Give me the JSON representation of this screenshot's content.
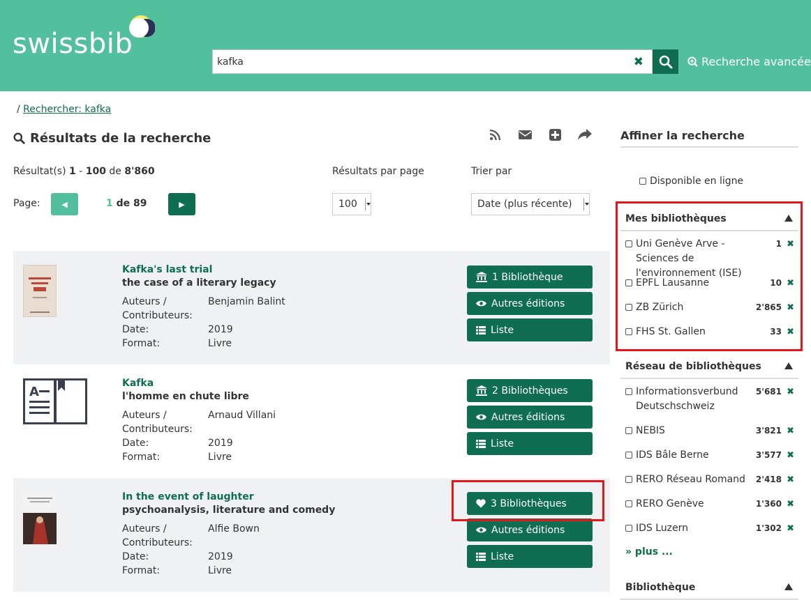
{
  "header": {
    "logo": "swissbib",
    "search_value": "kafka",
    "advanced_search": "Recherche avancée"
  },
  "breadcrumb": {
    "sep": "/",
    "link": "Rechercher: kafka"
  },
  "results": {
    "title": "Résultats de la recherche",
    "count_prefix": "Résultat(s)",
    "range_start": "1",
    "range_sep": "-",
    "range_end": "100",
    "of_word": "de",
    "total": "8'860",
    "per_page_label": "Résultats par page",
    "sort_label": "Trier par",
    "page_label": "Page:",
    "current_page": "1",
    "of_pages": "de 89",
    "per_page_value": "100",
    "sort_value": "Date (plus récente)"
  },
  "meta_labels": {
    "authors": "Auteurs /",
    "contributors": "Contributeurs:",
    "date": "Date:",
    "format": "Format:"
  },
  "records": [
    {
      "title": "Kafka's last trial",
      "subtitle": "the case of a literary legacy",
      "author": "Benjamin Balint",
      "date": "2019",
      "format": "Livre",
      "libraries_button": "1 Bibliothèque",
      "editions_button": "Autres éditions",
      "list_button": "Liste"
    },
    {
      "title": "Kafka",
      "subtitle": "l'homme en chute libre",
      "author": "Arnaud Villani",
      "date": "2019",
      "format": "Livre",
      "libraries_button": "2 Bibliothèques",
      "editions_button": "Autres éditions",
      "list_button": "Liste"
    },
    {
      "title": "In the event of laughter",
      "subtitle": "psychoanalysis, literature and comedy",
      "author": "Alfie Bown",
      "date": "2019",
      "format": "Livre",
      "libraries_button": "3 Bibliothèques",
      "editions_button": "Autres éditions",
      "list_button": "Liste"
    }
  ],
  "sidebar": {
    "title": "Affiner la recherche",
    "online": "Disponible en ligne",
    "my_libraries": {
      "title": "Mes bibliothèques",
      "items": [
        {
          "label": "Uni Genève Arve - Sciences de l'environnement (ISE)",
          "count": "1"
        },
        {
          "label": "EPFL Lausanne",
          "count": "10"
        },
        {
          "label": "ZB Zürich",
          "count": "2'865"
        },
        {
          "label": "FHS St. Gallen",
          "count": "33"
        }
      ]
    },
    "network": {
      "title": "Réseau de bibliothèques",
      "items": [
        {
          "label": "Informationsverbund Deutschschweiz",
          "count": "5'681"
        },
        {
          "label": "NEBIS",
          "count": "3'821"
        },
        {
          "label": "IDS Bâle Berne",
          "count": "3'577"
        },
        {
          "label": "RERO Réseau Romand",
          "count": "2'418"
        },
        {
          "label": "RERO Genève",
          "count": "1'360"
        },
        {
          "label": "IDS Luzern",
          "count": "1'302"
        }
      ],
      "more": "» plus ..."
    },
    "library_title": "Bibliothèque"
  },
  "colors": {
    "brand": "#52c09c",
    "dark": "#0e6e4f",
    "highlight": "#e3161a"
  }
}
